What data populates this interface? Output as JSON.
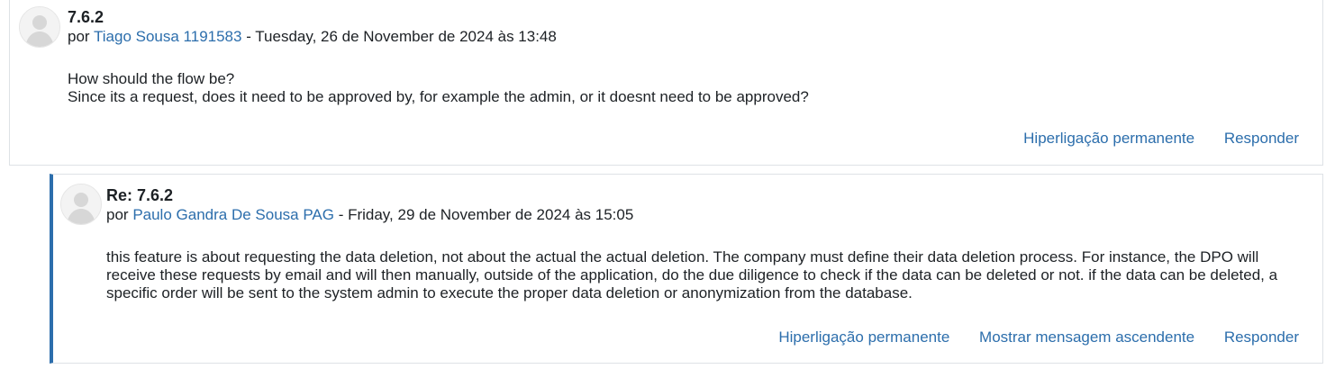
{
  "posts": [
    {
      "subject": "7.6.2",
      "by_prefix": "por",
      "author": "Tiago Sousa 1191583",
      "date": "Tuesday, 26 de November de 2024 às 13:48",
      "date_separator": " - ",
      "body": [
        "How should the flow be?",
        "Since its a request, does it need to be approved by, for example the admin, or it doesnt need to be approved?"
      ],
      "actions": {
        "permalink": "Hiperligação permanente",
        "reply": "Responder"
      }
    },
    {
      "subject": "Re: 7.6.2",
      "by_prefix": "por",
      "author": "Paulo Gandra De Sousa PAG",
      "date": "Friday, 29 de November de 2024 às 15:05",
      "date_separator": " - ",
      "body": [
        "this feature is about requesting the data deletion, not about the actual the actual deletion. The company must define their data deletion process. For instance, the DPO will receive these requests by email and will then manually, outside of the application, do the due diligence to check if the data can be deleted or not. if the data can be deleted, a specific order will be sent to the system admin to execute the proper data deletion or anonymization from the database."
      ],
      "actions": {
        "permalink": "Hiperligação permanente",
        "show_parent": "Mostrar mensagem ascendente",
        "reply": "Responder"
      }
    }
  ],
  "colors": {
    "link": "#2c6eac",
    "text": "#1d2125",
    "border": "#dee2e6",
    "reply_accent": "#2c6eac"
  },
  "icons": {
    "avatar": "user-avatar-icon"
  }
}
